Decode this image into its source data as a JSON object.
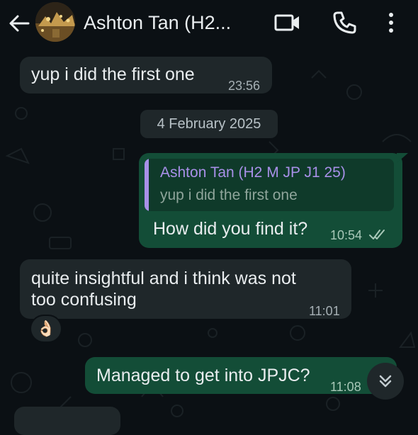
{
  "header": {
    "contact_name": "Ashton Tan (H2..."
  },
  "messages": {
    "m1": {
      "text": "yup i did the first one",
      "time": "23:56"
    },
    "date_divider": "4 February 2025",
    "m2": {
      "quote_author": "Ashton Tan (H2 M JP J1 25)",
      "quote_text": "yup i did the first one",
      "text": "How did you find it?",
      "time": "10:54",
      "status": "read"
    },
    "m3": {
      "line1": "quite insightful and i think was not",
      "line2": "too confusing",
      "time": "11:01",
      "reaction": "👌🏻"
    },
    "m4": {
      "text": "Managed to get into JPJC?",
      "time": "11:08"
    }
  },
  "icons": [
    "back-arrow-icon",
    "video-call-icon",
    "phone-icon",
    "more-options-icon",
    "double-check-icon",
    "chevron-double-down-icon"
  ],
  "colors": {
    "background": "#0b1014",
    "incoming_bubble": "#1f272a",
    "outgoing_bubble": "#134d37",
    "quote_accent": "#a890e8"
  }
}
